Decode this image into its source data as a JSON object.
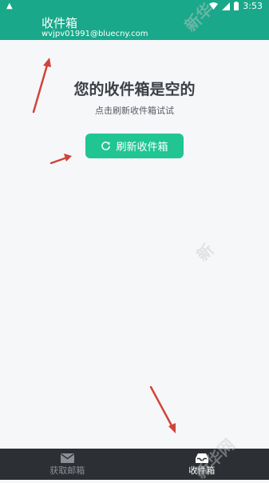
{
  "status_bar": {
    "time": "3:53"
  },
  "app_bar": {
    "title": "收件箱",
    "subtitle": "wvjpv01991@bluecny.com"
  },
  "empty_state": {
    "title": "您的收件箱是空的",
    "subtitle": "点击刷新收件箱试试",
    "refresh_label": "刷新收件箱"
  },
  "bottom_nav": {
    "items": [
      {
        "label": "获取邮箱",
        "icon": "mail-icon",
        "active": false
      },
      {
        "label": "收件箱",
        "icon": "inbox-tray-icon",
        "active": true
      }
    ]
  },
  "watermark": [
    "新华",
    "新",
    "新华网"
  ],
  "colors": {
    "primary": "#1aa88a",
    "button": "#20c592",
    "nav_background": "#2c2f33",
    "annotation_arrow": "#d0443a"
  }
}
